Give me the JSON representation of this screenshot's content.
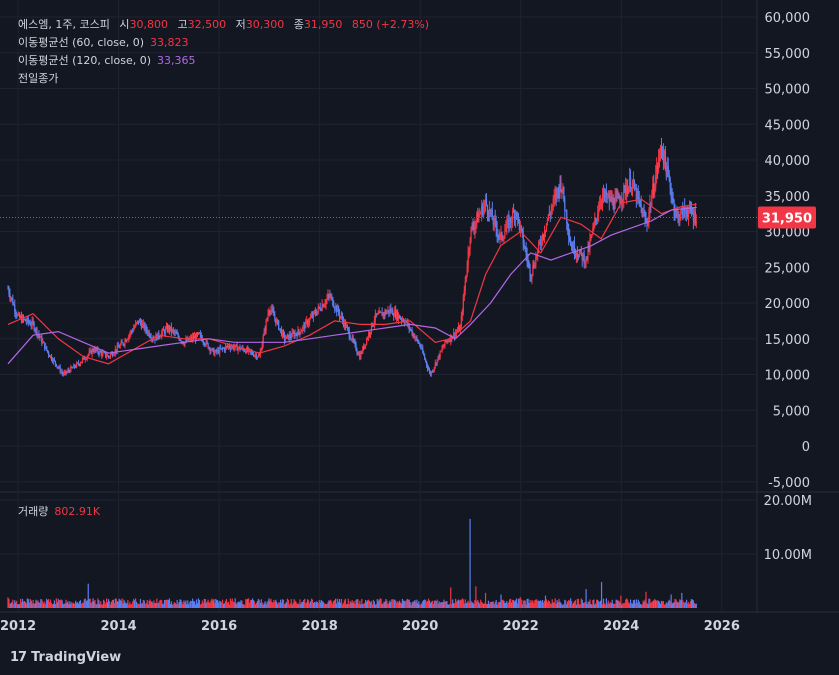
{
  "header": {
    "symbol": "에스엠, 1주, 코스피",
    "open_label": "시",
    "open": "30,800",
    "high_label": "고",
    "high": "32,500",
    "low_label": "저",
    "low": "30,300",
    "close_label": "종",
    "close": "31,950",
    "change": "850 (+2.73%)"
  },
  "indicators": [
    {
      "label": "이동평균선 (60, close, 0)",
      "value": "33,823",
      "color": "#f23645"
    },
    {
      "label": "이동평균선 (120, close, 0)",
      "value": "33,365",
      "color": "#b267e6"
    }
  ],
  "prev_close_label": "전일종가",
  "volume": {
    "label": "거래량",
    "value": "802.91K"
  },
  "current_price_tag": "31,950",
  "branding": "TradingView",
  "colors": {
    "up": "#f23645",
    "down": "#5b7ff0",
    "ma60": "#f23645",
    "ma120": "#b267e6",
    "background": "#131722",
    "grid": "#2a2e39"
  },
  "chart_data": [
    {
      "type": "line",
      "title": "에스엠, 1주, 코스피",
      "y_axis_ticks": [
        "60,000",
        "55,000",
        "50,000",
        "45,000",
        "40,000",
        "35,000",
        "30,000",
        "25,000",
        "20,000",
        "15,000",
        "10,000",
        "5,000",
        "0",
        "-5,000"
      ],
      "x_axis_ticks": [
        "2012",
        "2014",
        "2016",
        "2018",
        "2020",
        "2022",
        "2024",
        "2026"
      ],
      "ylim": [
        -5000,
        60000
      ],
      "grid": true,
      "series": [
        {
          "name": "종가",
          "x": [
            2011.8,
            2012.0,
            2012.3,
            2012.6,
            2012.9,
            2013.2,
            2013.5,
            2013.8,
            2014.1,
            2014.4,
            2014.7,
            2015.0,
            2015.3,
            2015.6,
            2015.9,
            2016.2,
            2016.5,
            2016.8,
            2017.0,
            2017.3,
            2017.6,
            2017.9,
            2018.2,
            2018.5,
            2018.8,
            2019.1,
            2019.4,
            2019.7,
            2020.0,
            2020.2,
            2020.5,
            2020.8,
            2021.0,
            2021.3,
            2021.6,
            2021.9,
            2022.2,
            2022.5,
            2022.8,
            2023.0,
            2023.3,
            2023.6,
            2023.9,
            2024.2,
            2024.5,
            2024.8,
            2025.1,
            2025.3,
            2025.5
          ],
          "values": [
            22000,
            18000,
            17000,
            13000,
            10000,
            11500,
            13500,
            12500,
            14500,
            17500,
            15000,
            16500,
            14500,
            15500,
            13000,
            14000,
            13500,
            12500,
            19500,
            15000,
            16000,
            18500,
            21000,
            17000,
            12500,
            18000,
            19000,
            17500,
            14000,
            10000,
            14500,
            16500,
            30000,
            34000,
            29000,
            33000,
            24000,
            31000,
            37000,
            28000,
            26000,
            35000,
            34000,
            37000,
            31000,
            42000,
            32000,
            33000,
            31950
          ]
        },
        {
          "name": "이동평균선 (60, close, 0)",
          "x": [
            2011.8,
            2012.3,
            2012.8,
            2013.3,
            2013.8,
            2014.3,
            2014.8,
            2015.3,
            2015.8,
            2016.3,
            2016.8,
            2017.3,
            2017.8,
            2018.3,
            2018.8,
            2019.3,
            2019.8,
            2020.3,
            2020.6,
            2021.0,
            2021.3,
            2021.6,
            2022.0,
            2022.4,
            2022.8,
            2023.2,
            2023.6,
            2024.0,
            2024.4,
            2024.8,
            2025.2,
            2025.5
          ],
          "values": [
            17000,
            18500,
            15000,
            12500,
            11500,
            13500,
            15500,
            15000,
            15000,
            14000,
            13000,
            14000,
            15500,
            17500,
            17000,
            17000,
            17500,
            14500,
            15000,
            17500,
            24000,
            28000,
            30000,
            27000,
            32000,
            31000,
            29000,
            34000,
            34500,
            32500,
            33500,
            33823
          ]
        },
        {
          "name": "이동평균선 (120, close, 0)",
          "x": [
            2011.8,
            2012.3,
            2012.8,
            2013.3,
            2013.8,
            2014.3,
            2014.8,
            2015.3,
            2015.8,
            2016.3,
            2016.8,
            2017.3,
            2017.8,
            2018.3,
            2018.8,
            2019.3,
            2019.8,
            2020.3,
            2020.7,
            2021.0,
            2021.4,
            2021.8,
            2022.2,
            2022.6,
            2023.0,
            2023.4,
            2023.8,
            2024.2,
            2024.6,
            2025.0,
            2025.5
          ],
          "values": [
            11500,
            15500,
            16000,
            14500,
            13000,
            13500,
            14000,
            14500,
            15000,
            14500,
            14500,
            14500,
            15000,
            15500,
            16000,
            16500,
            17000,
            16500,
            15000,
            17000,
            20000,
            24000,
            27000,
            26000,
            27000,
            28000,
            29500,
            30500,
            31500,
            33000,
            33365
          ]
        }
      ]
    },
    {
      "type": "bar",
      "title": "거래량",
      "y_axis_ticks": [
        "20.00M",
        "10.00M"
      ],
      "ylim": [
        0,
        20000000
      ],
      "series": [
        {
          "name": "거래량",
          "x": [
            2011.8,
            2012.5,
            2013.4,
            2014.5,
            2016.0,
            2017.0,
            2018.0,
            2019.0,
            2020.2,
            2020.6,
            2021.0,
            2021.1,
            2021.3,
            2021.6,
            2022.0,
            2022.5,
            2023.0,
            2023.3,
            2023.6,
            2024.0,
            2024.5,
            2025.0,
            2025.2,
            2025.5
          ],
          "values": [
            2000000,
            1200000,
            4500000,
            1500000,
            1000000,
            1800000,
            1500000,
            1300000,
            900000,
            3800000,
            16500000,
            4000000,
            2800000,
            2500000,
            2000000,
            2300000,
            1800000,
            3500000,
            4800000,
            2300000,
            3000000,
            2500000,
            2800000,
            802910
          ]
        }
      ]
    }
  ]
}
